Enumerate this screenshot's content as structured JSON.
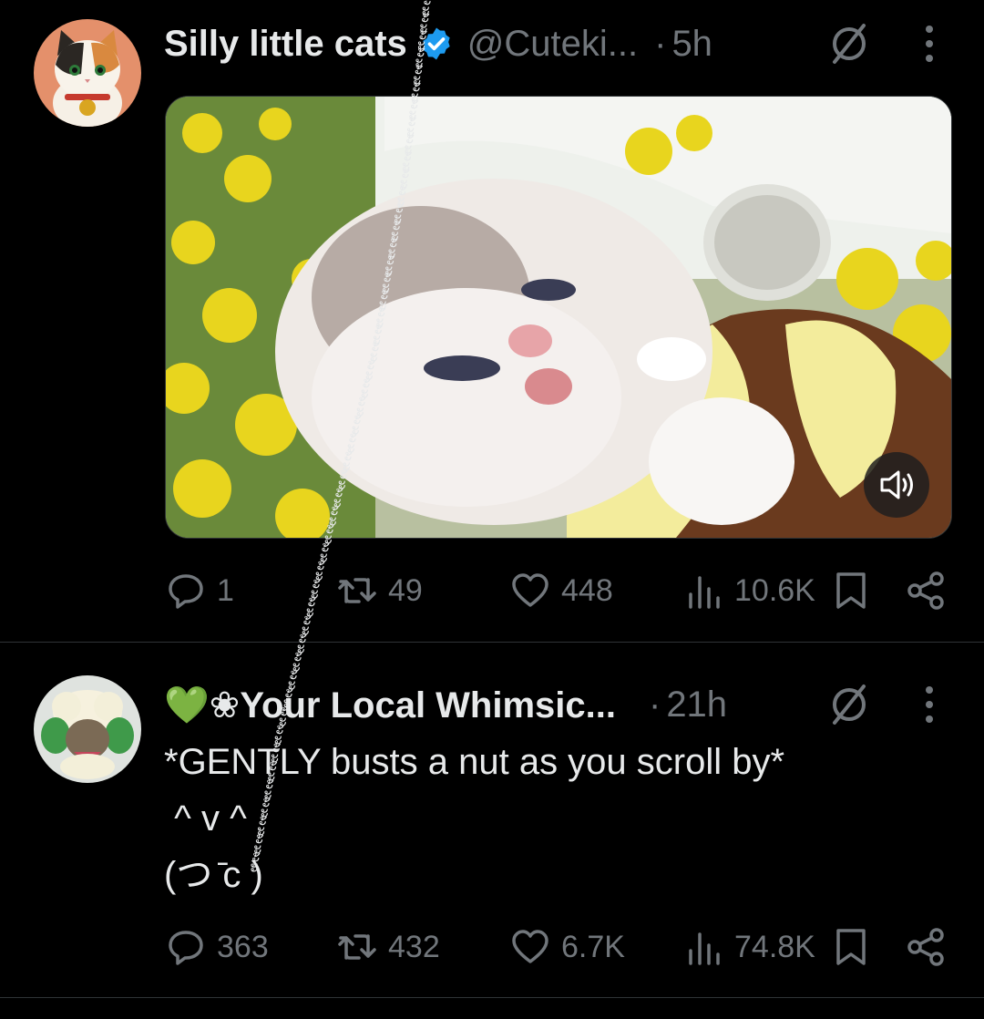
{
  "tweet1": {
    "name": "Silly little cats",
    "handle": "@Cuteki...",
    "separator": "·",
    "time": "5h",
    "actions": {
      "replies": "1",
      "retweets": "49",
      "likes": "448",
      "views": "10.6K"
    }
  },
  "tweet2": {
    "name": "💚❀Your Local Whimsic...",
    "separator": "·",
    "time": "21h",
    "text_line1": "*GENTLY busts a nut as you scroll by*",
    "text_line2": " ^ v ^",
    "text_line3": "(つ ̄c )",
    "actions": {
      "replies": "363",
      "retweets": "432",
      "likes": "6.7K",
      "views": "74.8K"
    }
  },
  "overlay_glyphs": "ะั้ะั้ะั้ะั้",
  "colors": {
    "background": "#000000",
    "text": "#e7e9ea",
    "secondary": "#71767b",
    "verified": "#1d9bf0",
    "divider": "#2f3336"
  }
}
